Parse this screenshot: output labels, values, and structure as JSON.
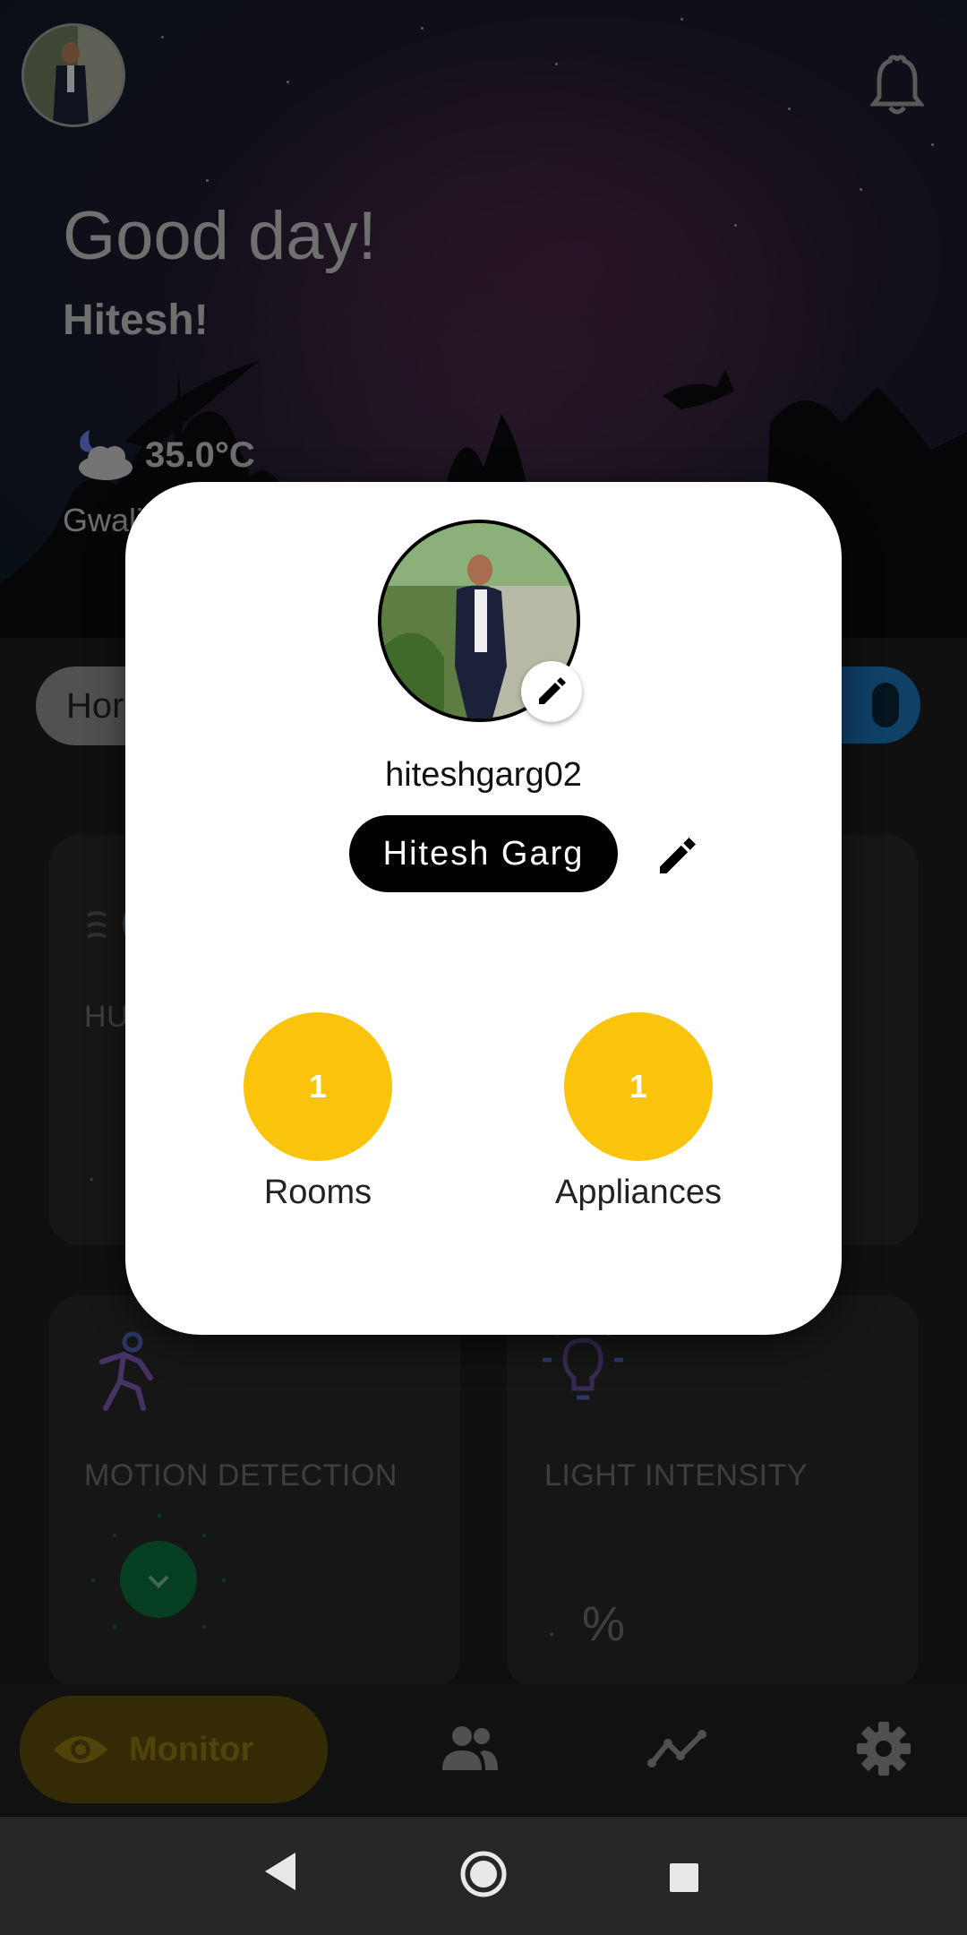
{
  "header": {
    "greeting": "Good day!",
    "user_name": "Hitesh!",
    "temperature": "35.0°C",
    "city": "Gwali"
  },
  "home_selector": {
    "label": "Hor"
  },
  "cards": {
    "humidity_label": "HU",
    "humidity_value": ".",
    "motion_label": "MOTION DETECTION",
    "light_label": "LIGHT INTENSITY",
    "light_value_dot": ".",
    "light_unit": "%"
  },
  "bottom_nav": {
    "monitor_label": "Monitor",
    "icons": [
      "eye-icon",
      "people-icon",
      "trend-icon",
      "gear-icon"
    ]
  },
  "profile_dialog": {
    "username": "hiteshgarg02",
    "display_name": "Hitesh Garg",
    "rooms": {
      "count": "1",
      "label": "Rooms"
    },
    "appliances": {
      "count": "1",
      "label": "Appliances"
    }
  },
  "colors": {
    "accent_yellow": "#fbc40c",
    "toggle_blue": "#1b6fb0",
    "motion_green": "#0b6b3a"
  }
}
